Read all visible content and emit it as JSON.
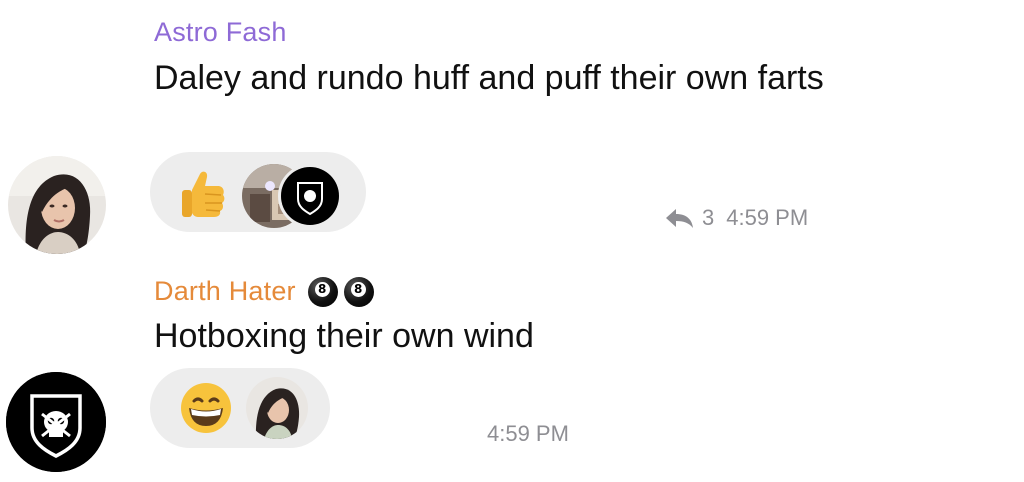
{
  "messages": [
    {
      "sender": "Astro Fash",
      "text": "Daley and rundo huff and puff their own farts",
      "reply_count": "3",
      "time": "4:59 PM",
      "sender_color": "#8e6ad6",
      "avatar": "woman-portrait",
      "reactions": [
        "thumbs-up-emoji",
        "user-avatar-photo",
        "user-avatar-shield"
      ]
    },
    {
      "sender": "Darth Hater",
      "badges": [
        "8-ball-emoji",
        "8-ball-emoji"
      ],
      "text": "Hotboxing their own wind",
      "time": "4:59 PM",
      "sender_color": "#e58a3a",
      "avatar": "shield-skull-logo",
      "reactions": [
        "grinning-face-emoji",
        "user-avatar-woman"
      ]
    }
  ]
}
